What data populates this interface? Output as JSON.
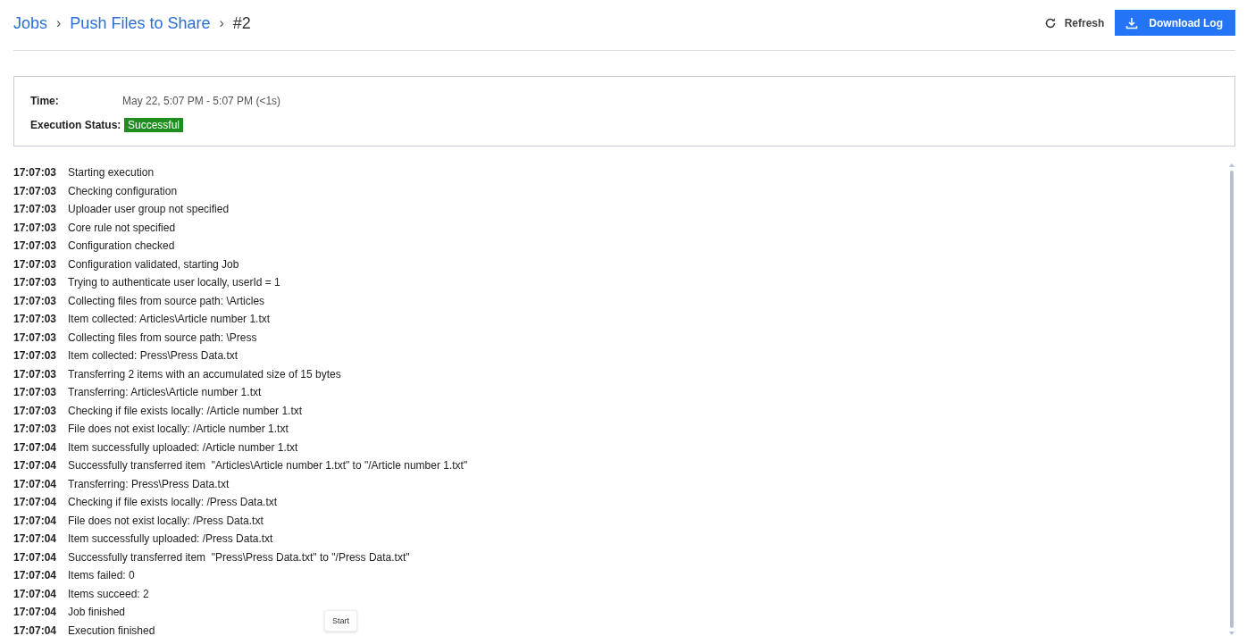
{
  "breadcrumb": [
    {
      "label": "Jobs",
      "kind": "link"
    },
    {
      "label": "›",
      "kind": "sep"
    },
    {
      "label": "Push Files to Share",
      "kind": "link"
    },
    {
      "label": "›",
      "kind": "sep"
    },
    {
      "label": "#2",
      "kind": "current"
    }
  ],
  "actions": {
    "refresh": "Refresh",
    "download": "Download Log"
  },
  "info": {
    "time_label": "Time:",
    "time": "May 22, 5:07 PM - 5:07 PM (<1s)",
    "status_label": "Execution Status:",
    "status": {
      "text": "Successful",
      "color": "#1e8e1e"
    }
  },
  "log": [
    {
      "time": "17:07:03",
      "message": "Starting execution"
    },
    {
      "time": "17:07:03",
      "message": "Checking configuration"
    },
    {
      "time": "17:07:03",
      "message": "Uploader user group not specified"
    },
    {
      "time": "17:07:03",
      "message": "Core rule not specified"
    },
    {
      "time": "17:07:03",
      "message": "Configuration checked"
    },
    {
      "time": "17:07:03",
      "message": "Configuration validated, starting Job"
    },
    {
      "time": "17:07:03",
      "message": "Trying to authenticate user locally, userId = 1"
    },
    {
      "time": "17:07:03",
      "message": "Collecting files from source path: \\Articles"
    },
    {
      "time": "17:07:03",
      "message": "Item collected: Articles\\Article number 1.txt"
    },
    {
      "time": "17:07:03",
      "message": "Collecting files from source path: \\Press"
    },
    {
      "time": "17:07:03",
      "message": "Item collected: Press\\Press Data.txt"
    },
    {
      "time": "17:07:03",
      "message": "Transferring 2 items with an accumulated size of 15 bytes"
    },
    {
      "time": "17:07:03",
      "message": "Transferring: Articles\\Article number 1.txt"
    },
    {
      "time": "17:07:03",
      "message": "Checking if file exists locally: /Article number 1.txt"
    },
    {
      "time": "17:07:03",
      "message": "File does not exist locally: /Article number 1.txt"
    },
    {
      "time": "17:07:04",
      "message": "Item successfully uploaded: /Article number 1.txt"
    },
    {
      "time": "17:07:04",
      "message": "Successfully transferred item  \"Articles\\Article number 1.txt\" to \"/Article number 1.txt\""
    },
    {
      "time": "17:07:04",
      "message": "Transferring: Press\\Press Data.txt"
    },
    {
      "time": "17:07:04",
      "message": "Checking if file exists locally: /Press Data.txt"
    },
    {
      "time": "17:07:04",
      "message": "File does not exist locally: /Press Data.txt"
    },
    {
      "time": "17:07:04",
      "message": "Item successfully uploaded: /Press Data.txt"
    },
    {
      "time": "17:07:04",
      "message": "Successfully transferred item  \"Press\\Press Data.txt\" to \"/Press Data.txt\""
    },
    {
      "time": "17:07:04",
      "message": "Items failed: 0"
    },
    {
      "time": "17:07:04",
      "message": "Items succeed: 2"
    },
    {
      "time": "17:07:04",
      "message": "Job finished"
    },
    {
      "time": "17:07:04",
      "message": "Execution finished"
    }
  ],
  "tooltip": "Start"
}
